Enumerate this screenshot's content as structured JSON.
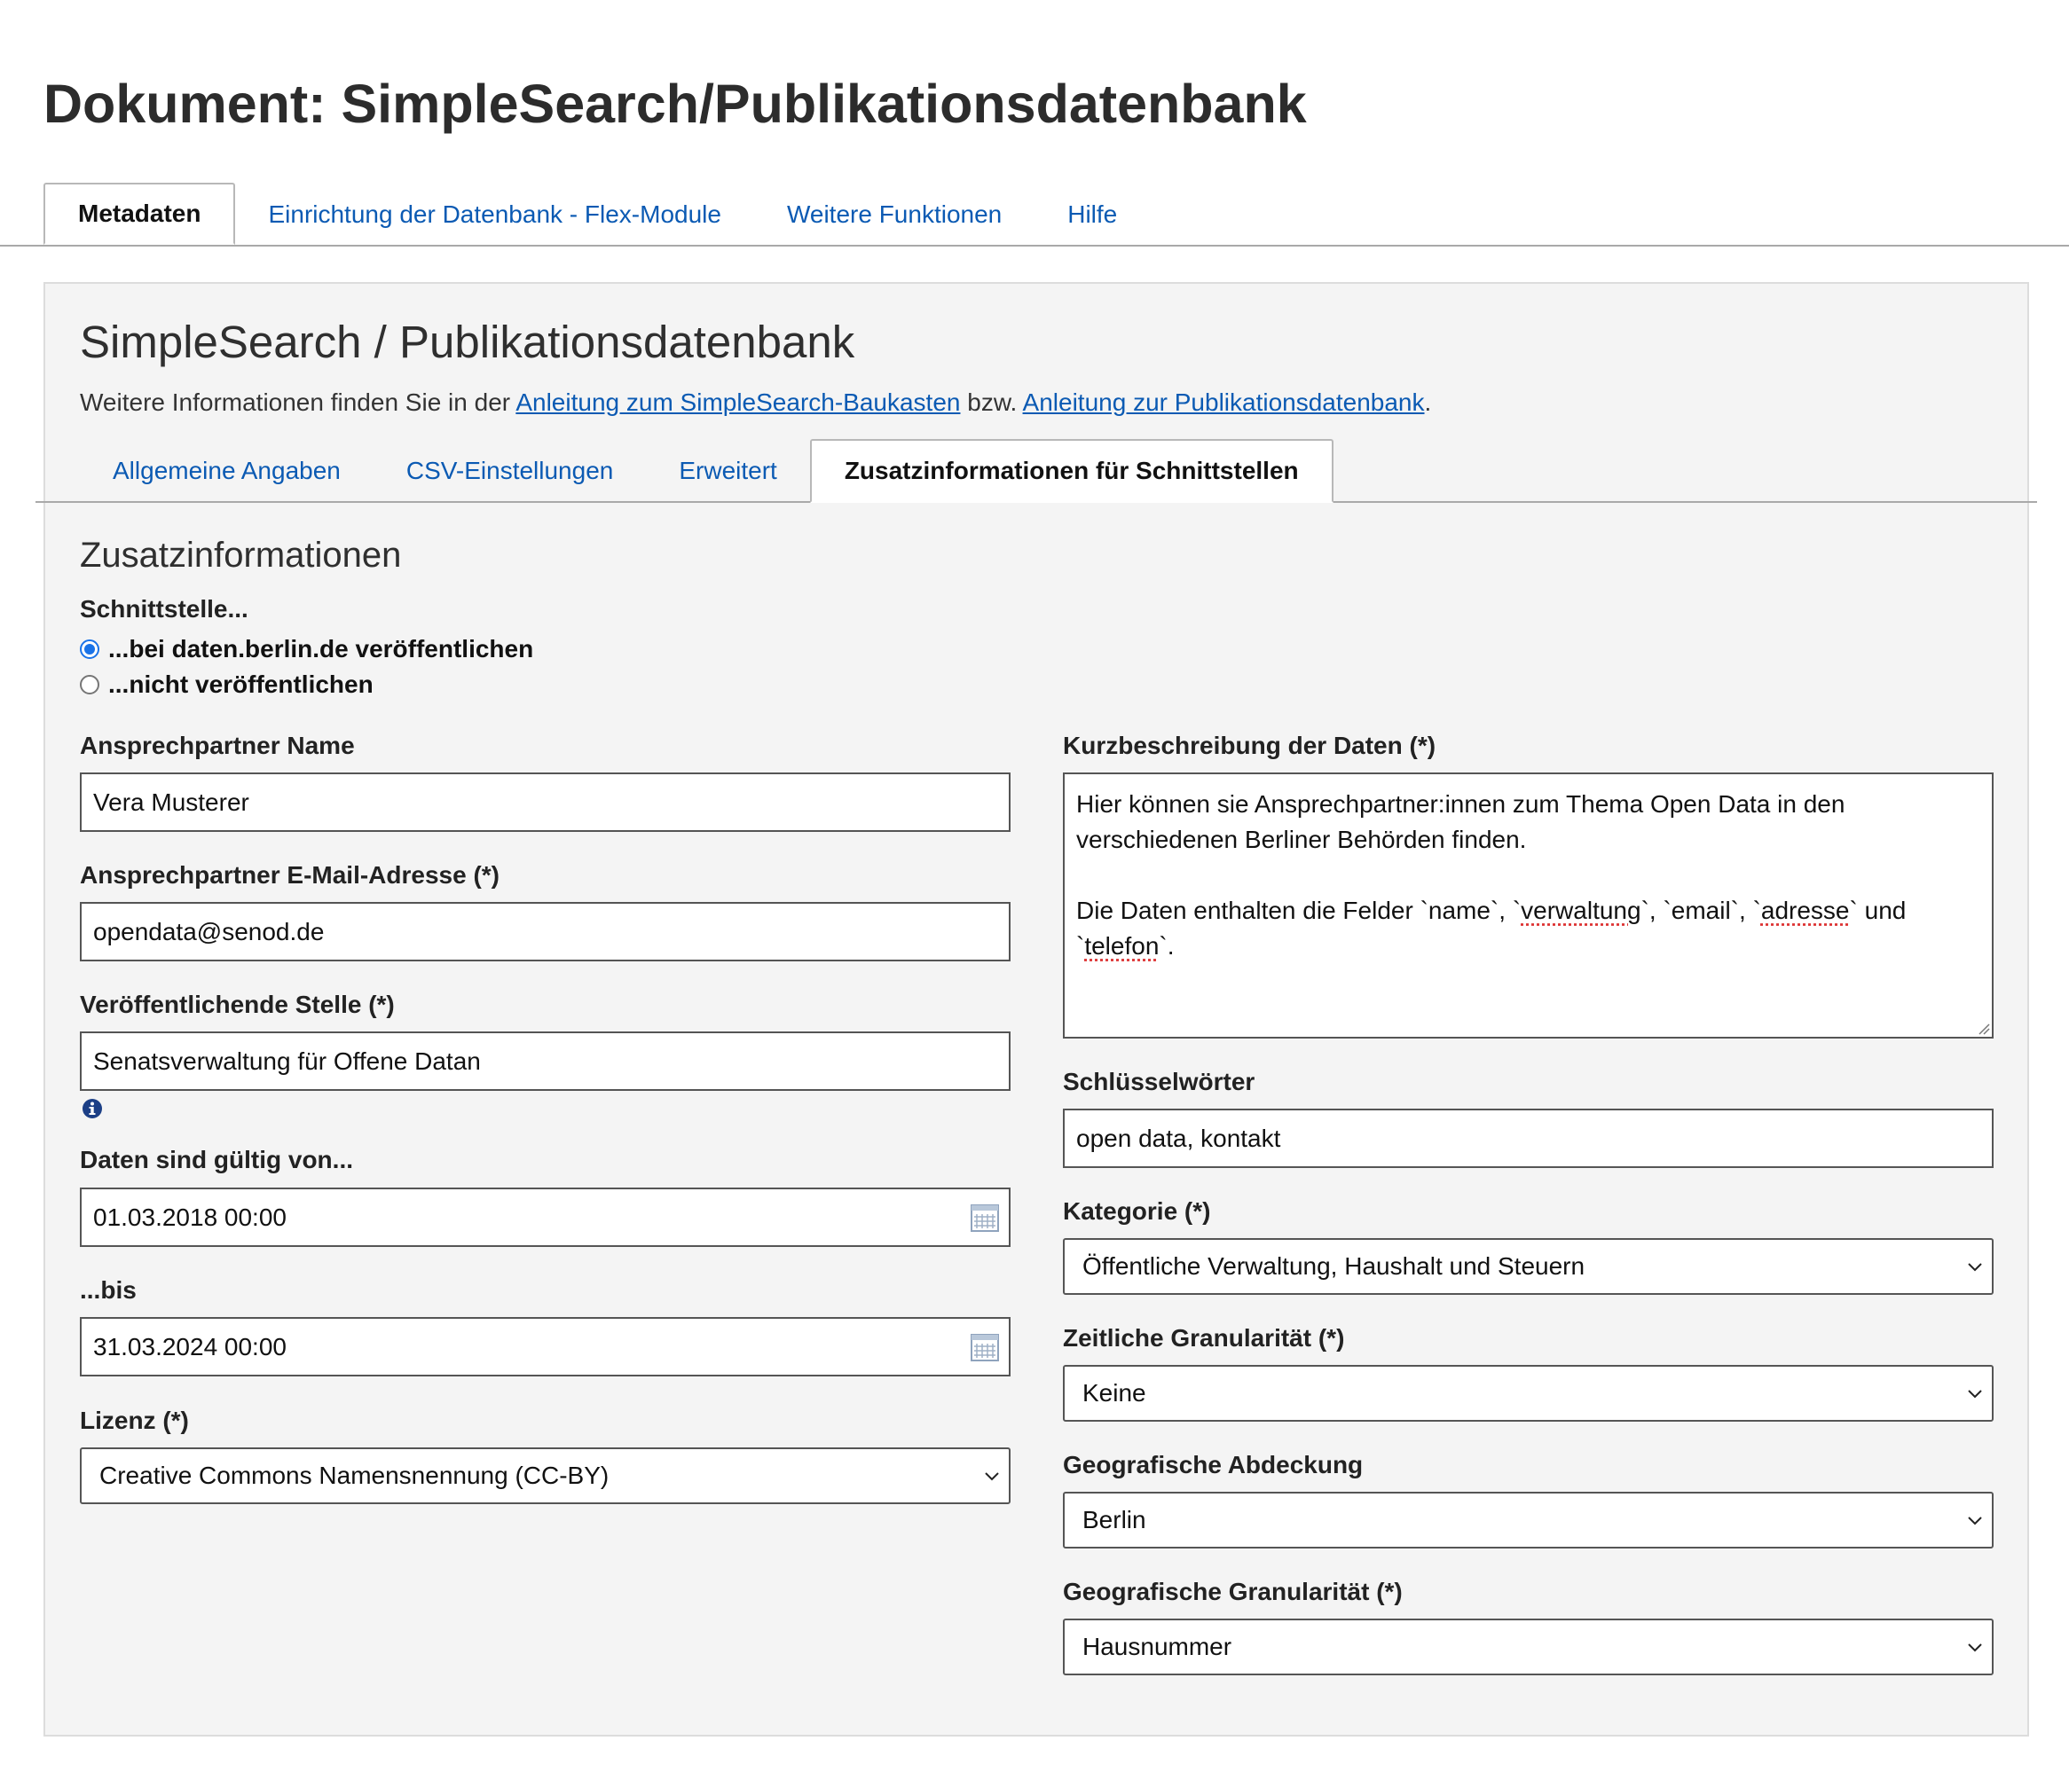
{
  "page": {
    "title": "Dokument: SimpleSearch/Publikationsdatenbank"
  },
  "top_tabs": [
    {
      "label": "Metadaten",
      "active": true
    },
    {
      "label": "Einrichtung der Datenbank - Flex-Module",
      "active": false
    },
    {
      "label": "Weitere Funktionen",
      "active": false
    },
    {
      "label": "Hilfe",
      "active": false
    }
  ],
  "panel": {
    "title": "SimpleSearch / Publikationsdatenbank",
    "info": {
      "prefix": "Weitere Informationen finden Sie in der ",
      "link1": "Anleitung zum SimpleSearch-Baukasten",
      "middle": " bzw. ",
      "link2": "Anleitung zur Publikationsdatenbank",
      "suffix": "."
    }
  },
  "sub_tabs": [
    {
      "label": "Allgemeine Angaben",
      "active": false
    },
    {
      "label": "CSV-Einstellungen",
      "active": false
    },
    {
      "label": "Erweitert",
      "active": false
    },
    {
      "label": "Zusatzinformationen für Schnittstellen",
      "active": true
    }
  ],
  "form": {
    "heading": "Zusatzinformationen",
    "interface": {
      "label": "Schnittstelle...",
      "options": [
        {
          "label": "...bei daten.berlin.de veröffentlichen",
          "checked": true
        },
        {
          "label": "...nicht veröffentlichen",
          "checked": false
        }
      ]
    },
    "contact_name": {
      "label": "Ansprechpartner Name",
      "value": "Vera Musterer"
    },
    "contact_email": {
      "label": "Ansprechpartner E-Mail-Adresse (*)",
      "value": "opendata@senod.de"
    },
    "publisher": {
      "label": "Veröffentlichende Stelle (*)",
      "value": "Senatsverwaltung für Offene Datan",
      "info_icon": "info-icon"
    },
    "valid_from": {
      "label": "Daten sind gültig von...",
      "value": "01.03.2018 00:00",
      "icon": "calendar-icon"
    },
    "valid_to": {
      "label": "...bis",
      "value": "31.03.2024 00:00",
      "icon": "calendar-icon"
    },
    "license": {
      "label": "Lizenz (*)",
      "value": "Creative Commons Namensnennung (CC-BY)"
    },
    "description": {
      "label": "Kurzbeschreibung der Daten (*)",
      "paragraph1": "Hier können sie Ansprechpartner:innen zum Thema Open Data in den verschiedenen Berliner Behörden finden.",
      "p2_a": "Die Daten enthalten die Felder `name`, `",
      "p2_w1": "verwaltung",
      "p2_b": "`, `email`, `",
      "p2_w2": "adresse",
      "p2_c": "` und `",
      "p2_w3": "telefon",
      "p2_d": "`."
    },
    "keywords": {
      "label": "Schlüsselwörter",
      "value": "open data, kontakt"
    },
    "category": {
      "label": "Kategorie (*)",
      "value": "Öffentliche Verwaltung, Haushalt und Steuern"
    },
    "time_granularity": {
      "label": "Zeitliche Granularität (*)",
      "value": "Keine"
    },
    "geo_coverage": {
      "label": "Geografische Abdeckung",
      "value": "Berlin"
    },
    "geo_granularity": {
      "label": "Geografische Granularität (*)",
      "value": "Hausnummer"
    }
  },
  "colors": {
    "link": "#0b5ab3",
    "panel_bg": "#f4f4f4",
    "radio_checked": "#1a73e8"
  }
}
